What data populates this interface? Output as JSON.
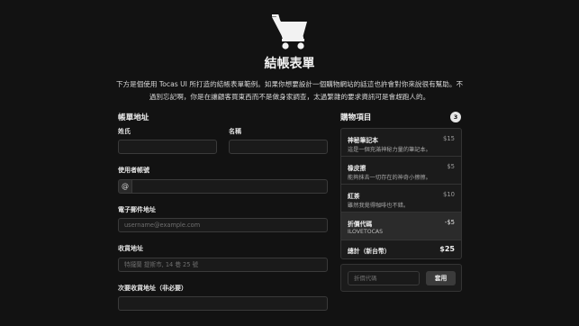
{
  "header": {
    "icon": "shopping-cart-icon",
    "title": "結帳表單",
    "description": "下方是個使用 Tocas UI 所打造的結帳表單範例。如果你想要設計一個購物網站的話這也許會對你來說很有幫助。不過別忘記啊，你是在讓顧客買東西而不是做身家調查，太過繁雜的要求資訊可是會趕跑人的。"
  },
  "billing": {
    "section_title": "帳單地址",
    "surname_label": "姓氏",
    "surname_value": "",
    "name_label": "名稱",
    "name_value": "",
    "username_label": "使用者帳號",
    "username_prefix": "@",
    "username_value": "",
    "email_label": "電子郵件地址",
    "email_placeholder": "username@example.com",
    "address_label": "收貨地址",
    "address_placeholder": "特攏蘭 提斯市, 14 巷 25 號",
    "address2_label": "次要收貨地址（非必要）",
    "address2_value": ""
  },
  "cart": {
    "section_title": "購物項目",
    "count": "3",
    "items": [
      {
        "name": "神秘筆記本",
        "desc": "這是一個充滿神秘力量的筆記本。",
        "price": "$15"
      },
      {
        "name": "橡皮擦",
        "desc": "能夠抹去一切存在的神奇小擦擦。",
        "price": "$5"
      },
      {
        "name": "紅茶",
        "desc": "雖然我覺得咖啡也不錯。",
        "price": "$10"
      }
    ],
    "promo": {
      "name": "折價代碼",
      "code": "ILOVETOCAS",
      "amount": "-$5"
    },
    "total": {
      "label": "總計（新台幣）",
      "amount": "$25"
    },
    "coupon_placeholder": "折價代碼",
    "apply_label": "套用"
  }
}
